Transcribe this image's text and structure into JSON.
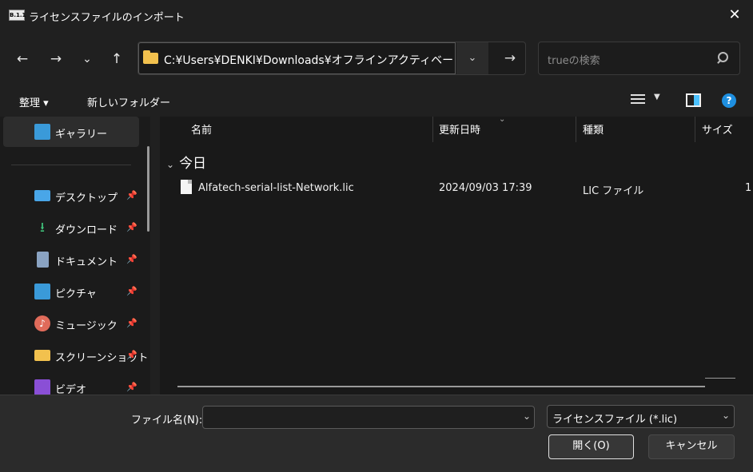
{
  "window": {
    "app_icon": "B.1.1",
    "title": "ライセンスファイルのインポート",
    "close_glyph": "✕"
  },
  "nav": {
    "back_glyph": "←",
    "forward_glyph": "→",
    "recent_glyph": "⌄",
    "up_glyph": "↑",
    "address_path": "C:¥Users¥DENKI¥Downloads¥オフラインアクティベート",
    "address_dropdown_glyph": "⌄",
    "go_glyph": "→",
    "search_placeholder": "trueの検索"
  },
  "commands": {
    "organize": "整理 ▾",
    "new_folder": "新しいフォルダー",
    "view_dropdown": "▼",
    "help": "?"
  },
  "sidebar": {
    "items": [
      {
        "label": "ギャラリー",
        "icon": "gallery-icon"
      },
      {
        "label": "デスクトップ",
        "icon": "desktop-icon",
        "pinned": true
      },
      {
        "label": "ダウンロード",
        "icon": "download-icon",
        "pinned": true
      },
      {
        "label": "ドキュメント",
        "icon": "document-icon",
        "pinned": true
      },
      {
        "label": "ピクチャ",
        "icon": "picture-icon",
        "pinned": true
      },
      {
        "label": "ミュージック",
        "icon": "music-icon",
        "pinned": true
      },
      {
        "label": "スクリーンショット",
        "icon": "folder-icon",
        "pinned": true
      },
      {
        "label": "ビデオ",
        "icon": "video-icon",
        "pinned": true
      }
    ],
    "pin_glyph": "📌",
    "download_glyph": "⭳",
    "music_glyph": "♪"
  },
  "files": {
    "columns": [
      "名前",
      "更新日時",
      "種類",
      "サイズ"
    ],
    "sort_glyph": "⌄",
    "group": "今日",
    "group_glyph": "⌄",
    "rows": [
      {
        "name": "Alfatech-serial-list-Network.lic",
        "modified": "2024/09/03 17:39",
        "type": "LIC ファイル",
        "size": "1"
      }
    ]
  },
  "footer": {
    "filename_label": "ファイル名(N):",
    "filename_value": "",
    "filename_dropdown_glyph": "⌄",
    "filter": "ライセンスファイル (*.lic)",
    "filter_dropdown_glyph": "⌄",
    "open_button": "開く(O)",
    "cancel_button": "キャンセル"
  },
  "colors": {
    "background": "#202020",
    "pane": "#191919",
    "accent": "#4cc2ff",
    "folder": "#f2c14e"
  }
}
